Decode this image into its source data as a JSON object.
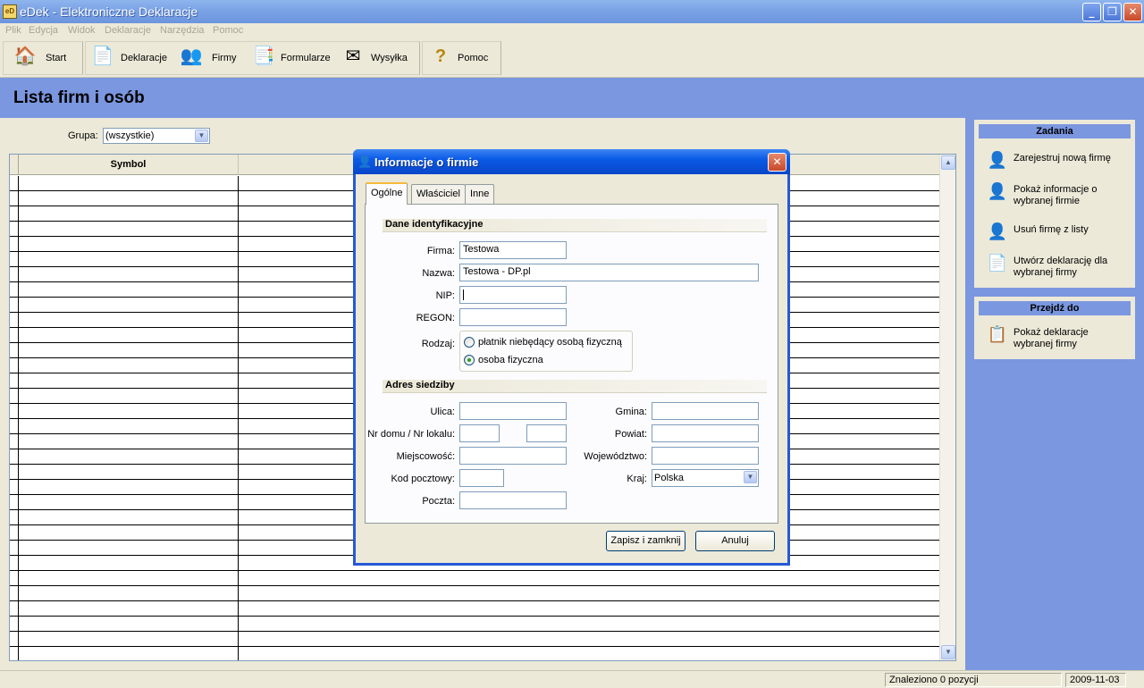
{
  "window": {
    "title": "eDek - Elektroniczne Deklaracje",
    "app_icon_text": "eD"
  },
  "menu": [
    "Plik",
    "Edycja",
    "Widok",
    "Deklaracje",
    "Narzędzia",
    "Pomoc"
  ],
  "toolbar": {
    "start": "Start",
    "deklaracje": "Deklaracje",
    "firmy": "Firmy",
    "formularze": "Formularze",
    "wysylka": "Wysyłka",
    "pomoc": "Pomoc"
  },
  "page": {
    "title": "Lista firm i osób",
    "grupa_label": "Grupa:",
    "grupa_value": "(wszystkie)",
    "column_symbol": "Symbol"
  },
  "side": {
    "tasks_header": "Zadania",
    "tasks": [
      "Zarejestruj nową firmę",
      "Pokaż informacje o wybranej firmie",
      "Usuń firmę z listy",
      "Utwórz deklarację dla wybranej firmy"
    ],
    "goto_header": "Przejdź do",
    "goto": [
      "Pokaż deklaracje wybranej firmy"
    ]
  },
  "status": {
    "found": "Znaleziono 0 pozycji",
    "date": "2009-11-03"
  },
  "dialog": {
    "title": "Informacje o firmie",
    "tabs": [
      "Ogólne",
      "Właściciel",
      "Inne"
    ],
    "section_ident": "Dane identyfikacyjne",
    "section_address": "Adres siedziby",
    "labels": {
      "firma": "Firma:",
      "nazwa": "Nazwa:",
      "nip": "NIP:",
      "regon": "REGON:",
      "rodzaj": "Rodzaj:",
      "ulica": "Ulica:",
      "nr": "Nr domu / Nr lokalu:",
      "miejscowosc": "Miejscowość:",
      "kod": "Kod pocztowy:",
      "poczta": "Poczta:",
      "gmina": "Gmina:",
      "powiat": "Powiat:",
      "wojewodztwo": "Województwo:",
      "kraj": "Kraj:"
    },
    "values": {
      "firma": "Testowa",
      "nazwa": "Testowa - DP.pl",
      "nip": "",
      "regon": "",
      "kraj": "Polska"
    },
    "rodzaj_options": [
      "płatnik niebędący osobą fizyczną",
      "osoba fizyczna"
    ],
    "rodzaj_selected": "osoba fizyczna",
    "save_button": "Zapisz i zamknij",
    "cancel_button": "Anuluj"
  },
  "icons": {
    "start": "home-icon",
    "deklaracje": "document-icon",
    "firmy": "people-icon",
    "formularze": "forms-icon",
    "wysylka": "envelope-icon",
    "pomoc": "help-icon"
  },
  "colors": {
    "header_blue": "#7b97e0",
    "title_blue": "#0a5ae6",
    "face": "#ece9d8"
  }
}
